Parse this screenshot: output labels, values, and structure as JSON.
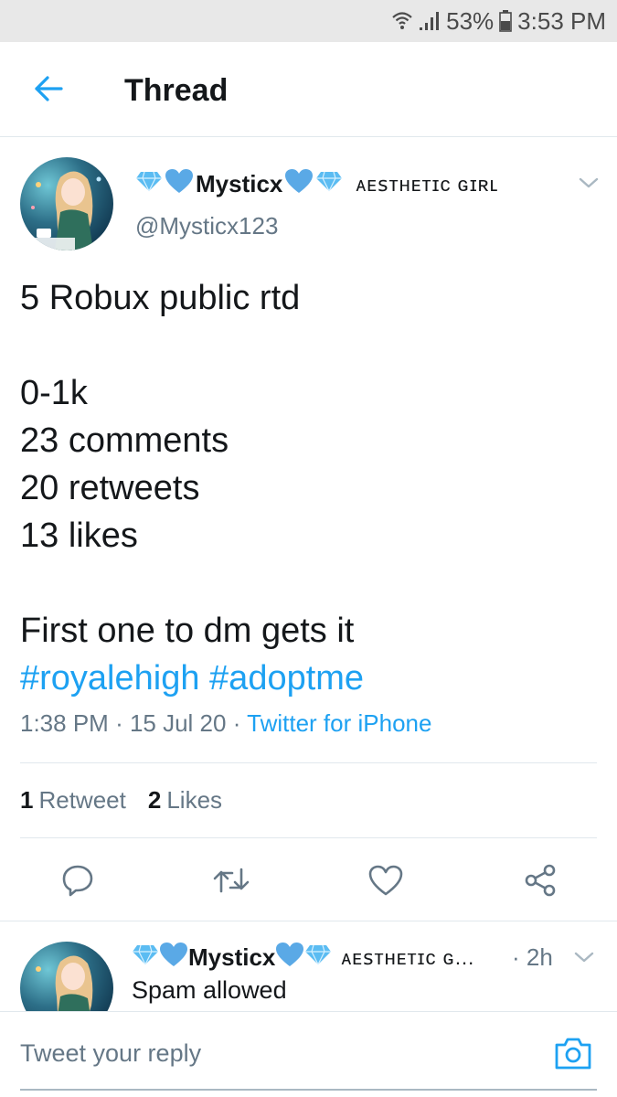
{
  "status_bar": {
    "battery": "53%",
    "time": "3:53 PM"
  },
  "header": {
    "title": "Thread",
    "back_icon": "arrow-left-icon"
  },
  "tweet": {
    "display_name": "Mysticx",
    "name_decoration": "ᴀᴇꜱᴛʜᴇᴛɪᴄ ɢɪʀʟ",
    "handle": "@Mysticx123",
    "text_line1": "5 Robux public rtd",
    "text_line2": "0-1k",
    "text_line3": "23 comments",
    "text_line4": "20 retweets",
    "text_line5": "13 likes",
    "text_line6": "First one to dm gets it",
    "hashtag1": "#royalehigh",
    "hashtag2": "#adoptme",
    "time": "1:38 PM",
    "date": "15 Jul 20",
    "source": "Twitter for iPhone",
    "retweet_count": "1",
    "retweet_label": "Retweet",
    "like_count": "2",
    "like_label": "Likes"
  },
  "reply": {
    "display_name": "Mysticx",
    "name_decoration": "ᴀᴇꜱᴛʜᴇᴛɪᴄ ɢ...",
    "time": "2h",
    "text": "Spam allowed"
  },
  "composer": {
    "placeholder": "Tweet your reply"
  },
  "colors": {
    "accent": "#1da1f2",
    "text": "#14171a",
    "muted": "#657786",
    "border": "#e1e8ed",
    "status_bar": "#e8e8e8"
  },
  "icons": [
    "wifi-icon",
    "signal-icon",
    "battery-icon",
    "arrow-left-icon",
    "chevron-down-icon",
    "reply-icon",
    "retweet-icon",
    "heart-icon",
    "share-icon",
    "camera-icon",
    "diamond-icon",
    "blue-heart-icon"
  ]
}
